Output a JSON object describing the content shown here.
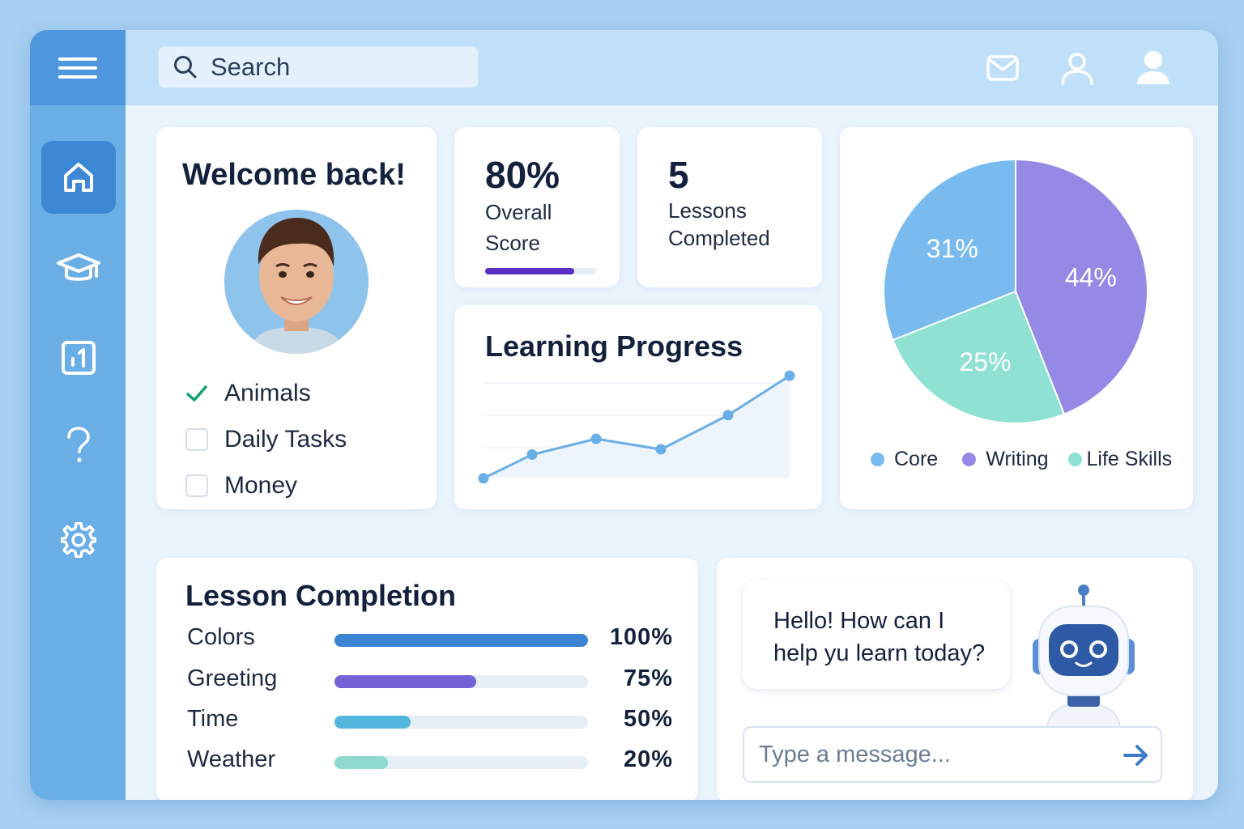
{
  "search": {
    "placeholder": "Search"
  },
  "sidebar": {
    "items": [
      {
        "name": "home",
        "icon": "home-icon",
        "active": true
      },
      {
        "name": "courses",
        "icon": "graduation-cap-icon",
        "active": false
      },
      {
        "name": "reports",
        "icon": "chart-icon",
        "active": false
      },
      {
        "name": "help",
        "icon": "question-icon",
        "active": false
      },
      {
        "name": "settings",
        "icon": "gear-icon",
        "active": false
      }
    ]
  },
  "header": {
    "icons": [
      "mail-icon",
      "user-outline-icon",
      "user-filled-icon"
    ]
  },
  "welcome": {
    "title": "Welcome back!",
    "lessons": [
      {
        "label": "Animals",
        "done": true
      },
      {
        "label": "Daily Tasks",
        "done": false
      },
      {
        "label": "Money",
        "done": false
      }
    ]
  },
  "score": {
    "value": "80%",
    "label_line1": "Overall",
    "label_line2": "Score",
    "progress": 0.8
  },
  "lessons_completed": {
    "value": "5",
    "label_line1": "Lessons",
    "label_line2": "Completed"
  },
  "progress": {
    "title": "Learning Progress",
    "chart_data": {
      "type": "line",
      "x": [
        1,
        2,
        3,
        4,
        5,
        6
      ],
      "values": [
        10,
        28,
        40,
        32,
        58,
        88
      ],
      "ylim": [
        0,
        100
      ],
      "grid": true
    }
  },
  "pie": {
    "chart_data": {
      "type": "pie",
      "categories": [
        "Writing",
        "Life Skills",
        "Core"
      ],
      "values": [
        44,
        25,
        31
      ],
      "labels": [
        "44%",
        "25%",
        "31%"
      ],
      "colors": [
        "#9489e5",
        "#8fe2d3",
        "#79bbef"
      ],
      "legend": [
        "Core",
        "Writing",
        "Life Skills"
      ],
      "legend_colors": [
        "#79bbef",
        "#9489e5",
        "#8fe2d3"
      ],
      "legend_position": "bottom"
    }
  },
  "completion": {
    "title": "Lesson Completion",
    "rows": [
      {
        "label": "Colors",
        "value": "100%",
        "fraction": 1.0,
        "color": "#3b83d3"
      },
      {
        "label": "Greeting",
        "value": "75%",
        "fraction": 0.56,
        "color": "#7363d6"
      },
      {
        "label": "Time",
        "value": "50%",
        "fraction": 0.3,
        "color": "#52b6de"
      },
      {
        "label": "Weather",
        "value": "20%",
        "fraction": 0.21,
        "color": "#8ed9d0"
      }
    ]
  },
  "chat": {
    "bubble_line1": "Hello! How can I",
    "bubble_line2": "help yu learn today?",
    "placeholder": "Type a message..."
  },
  "colors": {
    "accent": "#4f97dc",
    "sidebar": "#6aaee6",
    "topbar": "#bfe0f8"
  }
}
